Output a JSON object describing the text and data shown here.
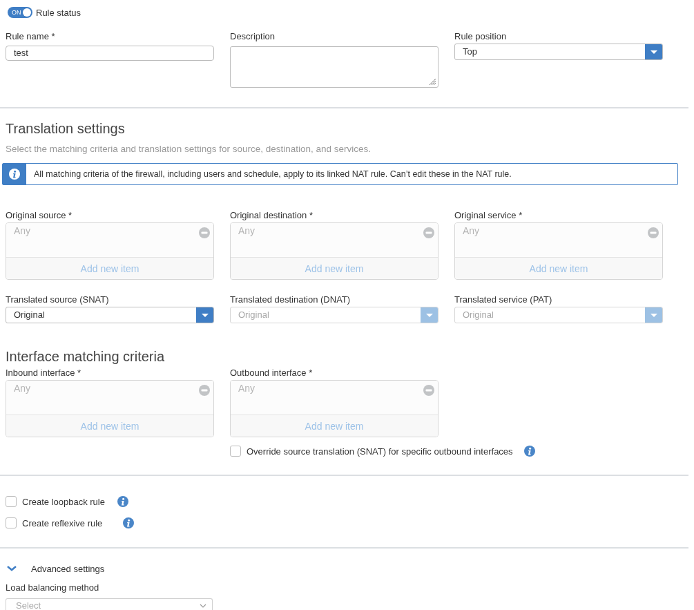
{
  "rule_status": {
    "toggle_text": "ON",
    "on": true,
    "label": "Rule status"
  },
  "fields": [
    {
      "kind": "text",
      "label": "Rule name *",
      "value": "test"
    },
    {
      "kind": "textarea",
      "label": "Description"
    },
    {
      "kind": "select",
      "label": "Rule position",
      "value": "Top",
      "disabled": false
    }
  ],
  "translation": {
    "title": "Translation settings",
    "subtitle": "Select the matching criteria and translation settings for source, destination, and services.",
    "notice": "All matching criteria of the firewall, including users and schedule, apply to its linked NAT rule. Can’t edit these in the NAT rule.",
    "item_lists": [
      {
        "label": "Original source *",
        "placeholder": "Any",
        "add_label": "Add new item"
      },
      {
        "label": "Original destination *",
        "placeholder": "Any",
        "add_label": "Add new item"
      },
      {
        "label": "Original service *",
        "placeholder": "Any",
        "add_label": "Add new item"
      }
    ],
    "selects": [
      {
        "label": "Translated source (SNAT)",
        "value": "Original",
        "disabled": false
      },
      {
        "label": "Translated destination (DNAT)",
        "value": "Original",
        "disabled": true
      },
      {
        "label": "Translated service (PAT)",
        "value": "Original",
        "disabled": true
      }
    ]
  },
  "interface": {
    "title": "Interface matching criteria",
    "item_lists": [
      {
        "label": "Inbound interface *",
        "placeholder": "Any",
        "add_label": "Add new item"
      },
      {
        "label": "Outbound interface *",
        "placeholder": "Any",
        "add_label": "Add new item"
      }
    ],
    "override": {
      "label": "Override source translation (SNAT) for specific outbound interfaces",
      "checked": false
    }
  },
  "options": [
    {
      "label": "Create loopback rule",
      "checked": false
    },
    {
      "label": "Create reflexive rule",
      "checked": false
    }
  ],
  "advanced": {
    "label": "Advanced settings",
    "expanded": true,
    "load_balancing": {
      "label": "Load balancing method",
      "placeholder": "Select"
    }
  }
}
